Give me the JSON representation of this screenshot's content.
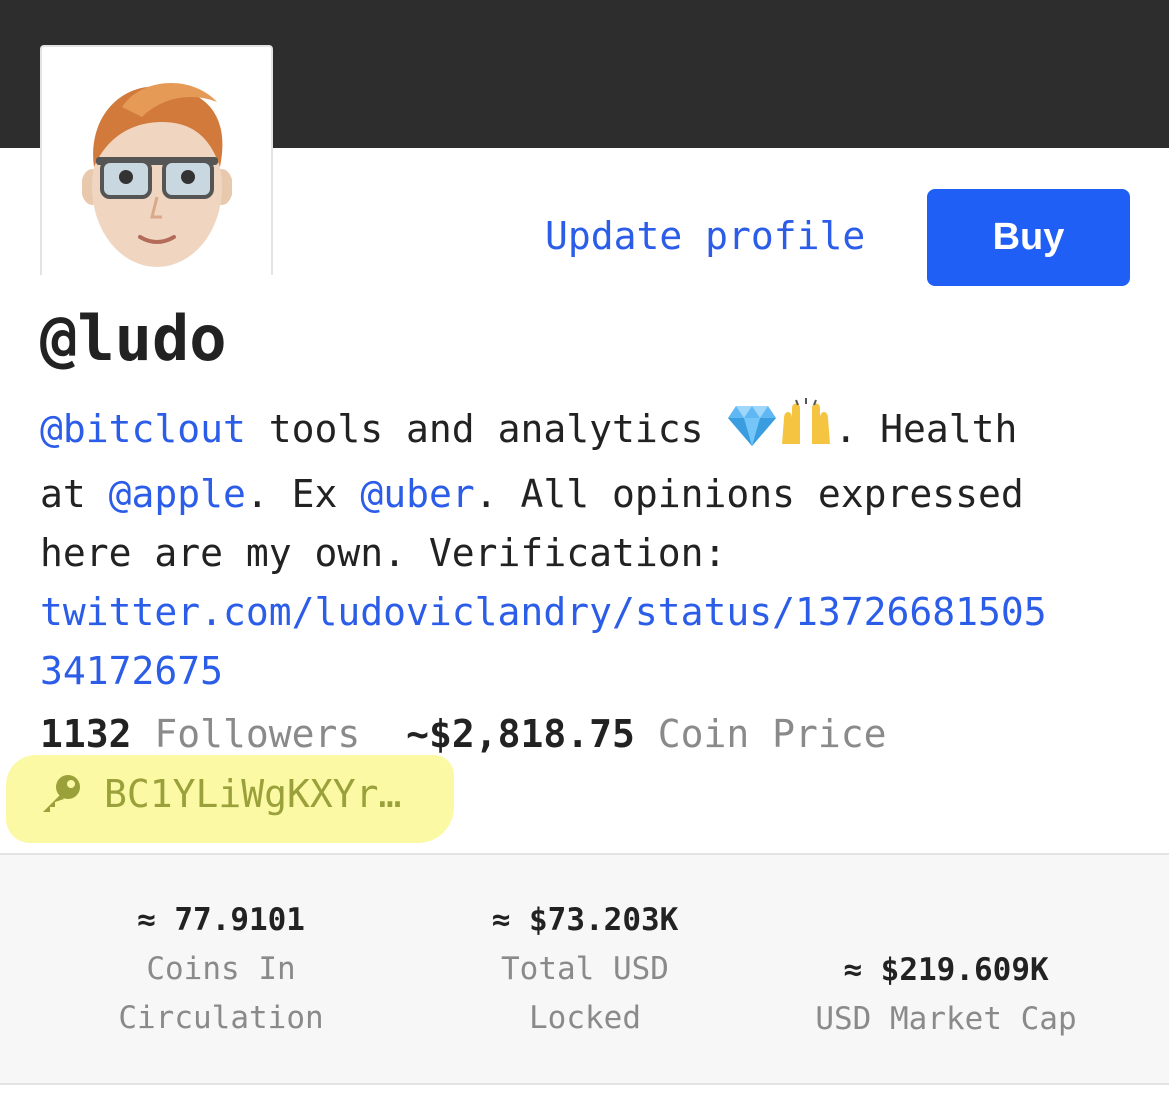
{
  "profile": {
    "username": "@ludo",
    "update_label": "Update profile",
    "buy_label": "Buy",
    "bio": {
      "mention1": "@bitclout",
      "text1": " tools and analytics ",
      "text2": ". Health",
      "text3": "at ",
      "mention2": "@apple",
      "text4": ". Ex ",
      "mention3": "@uber",
      "text5": ". All opinions expressed",
      "text6": "here are my own. Verification:",
      "link_line1": "twitter.com/ludoviclandry/status/13726681505",
      "link_line2": "34172675"
    },
    "followers_count": "1132",
    "followers_label": "Followers",
    "coin_price": "~$2,818.75",
    "coin_price_label": "Coin Price",
    "public_key": "BC1YLiWgKXYr…",
    "key_icon": "key-icon",
    "highlight_color": "#fbf9a3"
  },
  "metrics": [
    {
      "value": "≈ 77.9101",
      "caption1": "Coins In",
      "caption2": "Circulation"
    },
    {
      "value": "≈ $73.203K",
      "caption1": "Total USD",
      "caption2": "Locked"
    },
    {
      "value": "≈ $219.609K",
      "caption1": "USD Market Cap",
      "caption2": ""
    }
  ],
  "colors": {
    "accent": "#2b5de8",
    "buy": "#1f5ff5",
    "banner": "#2d2d2d"
  }
}
